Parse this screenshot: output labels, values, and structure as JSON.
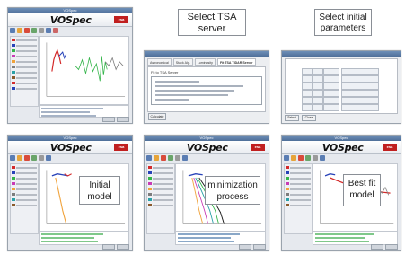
{
  "app": {
    "window_title": "VOSpec",
    "logo": "VOSpec",
    "org_logo": "esa"
  },
  "callouts": {
    "tsa": "Select TSA server",
    "params": "Select initial parameters",
    "initial": "Initial model",
    "minimization": "minimization process",
    "bestfit": "Best fit model"
  },
  "tsa_dialog": {
    "tabs": [
      "Astronomical",
      "Stack Alg.",
      "Luminosity",
      "Fit TSA TIDAR Server"
    ],
    "server_label": "Fit to TSA Server",
    "button": "Calculate"
  },
  "params_dialog": {
    "buttons": [
      "Select",
      "Close"
    ]
  },
  "colors": {
    "curve_red": "#d42a2a",
    "curve_green": "#34b54a",
    "curve_blue": "#2742b8",
    "curve_magenta": "#c93bb4",
    "curve_orange": "#f0a23a",
    "curve_gray": "#7c7c7c",
    "callout_border": "#8a8f96"
  }
}
